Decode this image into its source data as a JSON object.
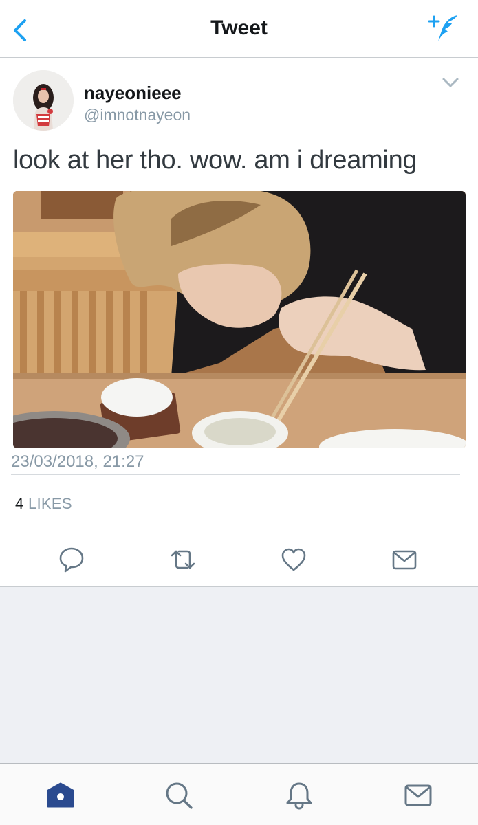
{
  "nav": {
    "title": "Tweet",
    "back_icon": "chevron-left-icon",
    "compose_icon": "compose-tweet-icon",
    "accent": "#1da1f2"
  },
  "tweet": {
    "display_name": "nayeonieee",
    "handle": "@imnotnayeon",
    "text": "look at her tho. wow. am i dreaming",
    "timestamp": "23/03/2018, 21:27",
    "likes_count": "4",
    "likes_label": "LIKES",
    "menu_icon": "chevron-down-icon",
    "actions": [
      "reply-icon",
      "retweet-icon",
      "like-icon",
      "direct-message-icon"
    ]
  },
  "tabbar": {
    "tabs": [
      "home-icon",
      "search-icon",
      "notifications-icon",
      "messages-icon"
    ],
    "active": "home",
    "active_color": "#2a4a8f"
  }
}
